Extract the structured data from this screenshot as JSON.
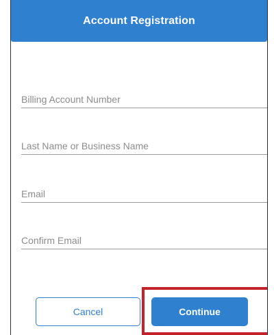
{
  "header": {
    "title": "Account Registration"
  },
  "form": {
    "billing_account_number": {
      "placeholder": "Billing Account Number",
      "value": ""
    },
    "last_name": {
      "placeholder": "Last Name or Business Name",
      "value": ""
    },
    "email": {
      "placeholder": "Email",
      "value": ""
    },
    "confirm_email": {
      "placeholder": "Confirm Email",
      "value": ""
    }
  },
  "actions": {
    "cancel_label": "Cancel",
    "continue_label": "Continue"
  },
  "colors": {
    "accent": "#2f80cf",
    "highlight": "#c4222a",
    "placeholder": "#8c8c8c"
  }
}
